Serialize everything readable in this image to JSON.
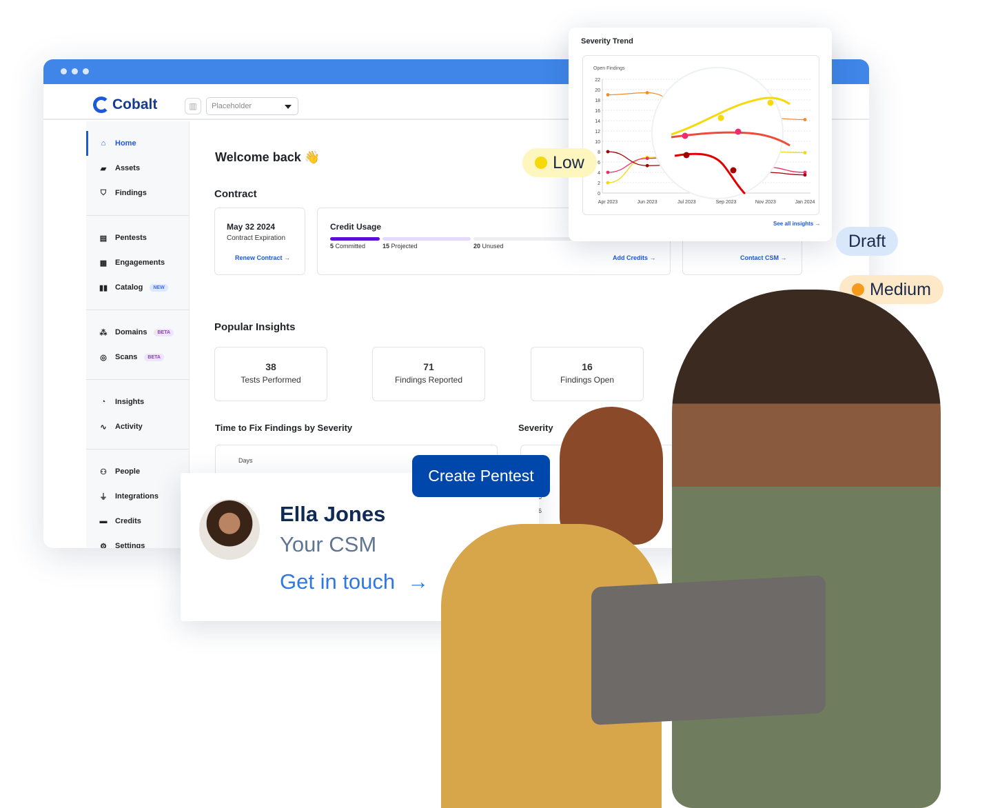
{
  "app": {
    "brand": "Cobalt",
    "workspace_select": {
      "value": "Placeholder"
    }
  },
  "sidebar": {
    "groups": [
      [
        {
          "label": "Home",
          "icon": "home-icon",
          "active": true
        },
        {
          "label": "Assets",
          "icon": "folder-icon"
        },
        {
          "label": "Findings",
          "icon": "shield-icon"
        }
      ],
      [
        {
          "label": "Pentests",
          "icon": "pentest-icon"
        },
        {
          "label": "Engagements",
          "icon": "building-icon"
        },
        {
          "label": "Catalog",
          "icon": "book-icon",
          "badge": "NEW"
        }
      ],
      [
        {
          "label": "Domains",
          "icon": "sitemap-icon",
          "badge": "BETA"
        },
        {
          "label": "Scans",
          "icon": "target-icon",
          "badge": "BETA"
        }
      ],
      [
        {
          "label": "Insights",
          "icon": "pie-icon"
        },
        {
          "label": "Activity",
          "icon": "pulse-icon"
        }
      ],
      [
        {
          "label": "People",
          "icon": "people-icon"
        },
        {
          "label": "Integrations",
          "icon": "plug-icon"
        },
        {
          "label": "Credits",
          "icon": "wallet-icon"
        },
        {
          "label": "Settings",
          "icon": "gear-icon"
        }
      ]
    ]
  },
  "main": {
    "welcome": "Welcome back 👋",
    "contract_title": "Contract",
    "contract": {
      "date": "May 32 2024",
      "label": "Contract Expiration",
      "link": "Renew Contract →"
    },
    "credit": {
      "title": "Credit Usage",
      "committed_n": "5",
      "committed": " Committed",
      "projected_n": "15",
      "projected": " Projected",
      "unused_n": "20",
      "unused": " Unused",
      "link": "Add Credits →",
      "colors": {
        "committed": "#5b10d6",
        "projected": "#e6d9fb",
        "unused": "#eceef1"
      }
    },
    "csm_card": {
      "link": "Contact CSM →"
    },
    "insights_title": "Popular Insights",
    "insights": [
      {
        "value": "38",
        "label": "Tests Performed"
      },
      {
        "value": "71",
        "label": "Findings Reported"
      },
      {
        "value": "16",
        "label": "Findings Open"
      }
    ],
    "ttf_title": "Time to Fix Findings by Severity",
    "ttf_axis": "Days",
    "severity_title": "Severity",
    "severity_ticks": [
      "18",
      "16"
    ]
  },
  "chart_data": {
    "type": "line",
    "title": "Severity Trend",
    "ylabel": "Open Findings",
    "ylim": [
      0,
      22
    ],
    "yticks": [
      0,
      2,
      4,
      6,
      8,
      10,
      12,
      14,
      16,
      18,
      20,
      22
    ],
    "categories": [
      "Apr 2023",
      "Jun 2023",
      "Jul 2023",
      "Sep 2023",
      "Nov 2023",
      "Jan 2024"
    ],
    "grid": true,
    "series": [
      {
        "color": "#f28c28",
        "values": [
          19,
          19.4,
          17,
          15.5,
          14.5,
          14.2
        ]
      },
      {
        "color": "#f5d90a",
        "values": [
          2,
          6.9,
          7.5,
          8,
          8,
          7.8
        ]
      },
      {
        "color": "#ef2b6a",
        "values": [
          4,
          6.7,
          7.3,
          6,
          5,
          4
        ]
      },
      {
        "color": "#a30000",
        "values": [
          8,
          5.3,
          5.6,
          5,
          4,
          3.5
        ]
      }
    ],
    "footer_link": "See all insights →"
  },
  "tags": {
    "low": {
      "label": "Low",
      "color": "#f5d90a"
    },
    "draft": {
      "label": "Draft"
    },
    "medium": {
      "label": "Medium",
      "color": "#f59a1b"
    }
  },
  "cta": {
    "label": "Create Pentest"
  },
  "csm": {
    "name": "Ella Jones",
    "role": "Your CSM",
    "link": "Get in touch"
  }
}
